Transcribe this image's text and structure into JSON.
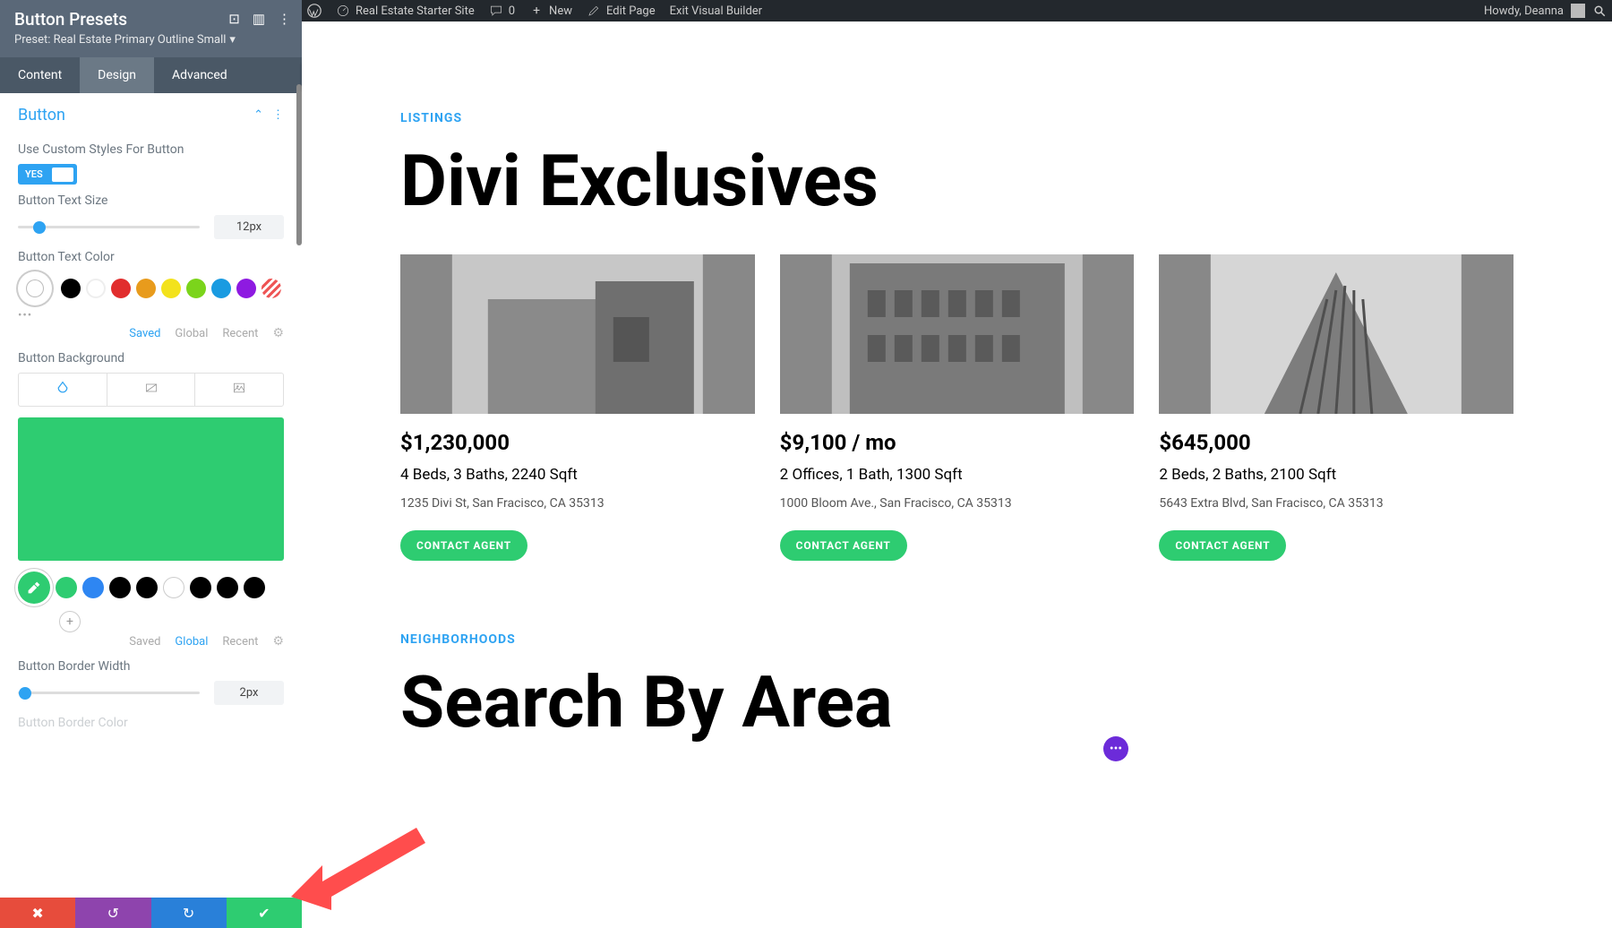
{
  "wp_bar": {
    "site": "Real Estate Starter Site",
    "comments": "0",
    "new": "New",
    "edit": "Edit Page",
    "exit": "Exit Visual Builder",
    "howdy": "Howdy, Deanna"
  },
  "panel": {
    "title": "Button Presets",
    "preset_label": "Preset: Real Estate Primary Outline Small",
    "tabs": {
      "content": "Content",
      "design": "Design",
      "advanced": "Advanced"
    },
    "section": "Button",
    "custom_styles_label": "Use Custom Styles For Button",
    "toggle_yes": "YES",
    "text_size_label": "Button Text Size",
    "text_size_value": "12px",
    "text_color_label": "Button Text Color",
    "palette_meta": {
      "saved": "Saved",
      "global": "Global",
      "recent": "Recent"
    },
    "bg_label": "Button Background",
    "bg_meta": {
      "saved": "Saved",
      "global": "Global",
      "recent": "Recent"
    },
    "border_width_label": "Button Border Width",
    "border_width_value": "2px",
    "border_color_label": "Button Border Color"
  },
  "text_color_swatches": [
    "#000000",
    "#ffffff",
    "#e12d2d",
    "#e89b1c",
    "#f3e21c",
    "#7bd41b",
    "#1a9be1",
    "#8e1ae1"
  ],
  "bg_preview_color": "#2ecc71",
  "bg_swatches": [
    "#2ecc71",
    "#2e86f2",
    "#000000",
    "#000000",
    "#ffffff",
    "#000000",
    "#000000",
    "#000000"
  ],
  "canvas": {
    "eyebrow1": "LISTINGS",
    "heading1": "Divi Exclusives",
    "cards": [
      {
        "price": "$1,230,000",
        "specs": "4 Beds, 3 Baths, 2240 Sqft",
        "addr": "1235 Divi St, San Fracisco, CA 35313",
        "btn": "CONTACT AGENT"
      },
      {
        "price": "$9,100 / mo",
        "specs": "2 Offices, 1 Bath, 1300 Sqft",
        "addr": "1000 Bloom Ave., San Fracisco, CA 35313",
        "btn": "CONTACT AGENT"
      },
      {
        "price": "$645,000",
        "specs": "2 Beds, 2 Baths, 2100 Sqft",
        "addr": "5643 Extra Blvd, San Fracisco, CA 35313",
        "btn": "CONTACT AGENT"
      }
    ],
    "eyebrow2": "NEIGHBORHOODS",
    "heading2": "Search By Area"
  }
}
